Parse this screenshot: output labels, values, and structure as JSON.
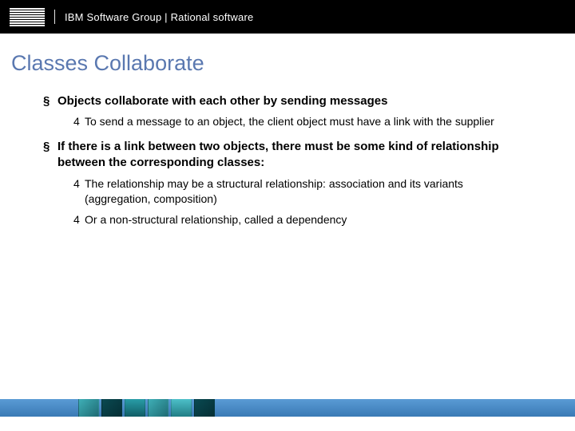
{
  "header": {
    "logo_name": "ibm-logo",
    "text": "IBM Software Group | Rational software"
  },
  "title": "Classes Collaborate",
  "bullets": [
    {
      "text": "Objects collaborate with each other by sending messages",
      "sub": [
        "To send a message to an object, the client object must have a link with the supplier"
      ]
    },
    {
      "text": "If there is a link between two objects, there must be some kind of relationship between the corresponding classes:",
      "sub": [
        "The relationship may be a structural relationship: association and its variants (aggregation, composition)",
        "Or a non-structural relationship, called a dependency"
      ]
    }
  ]
}
